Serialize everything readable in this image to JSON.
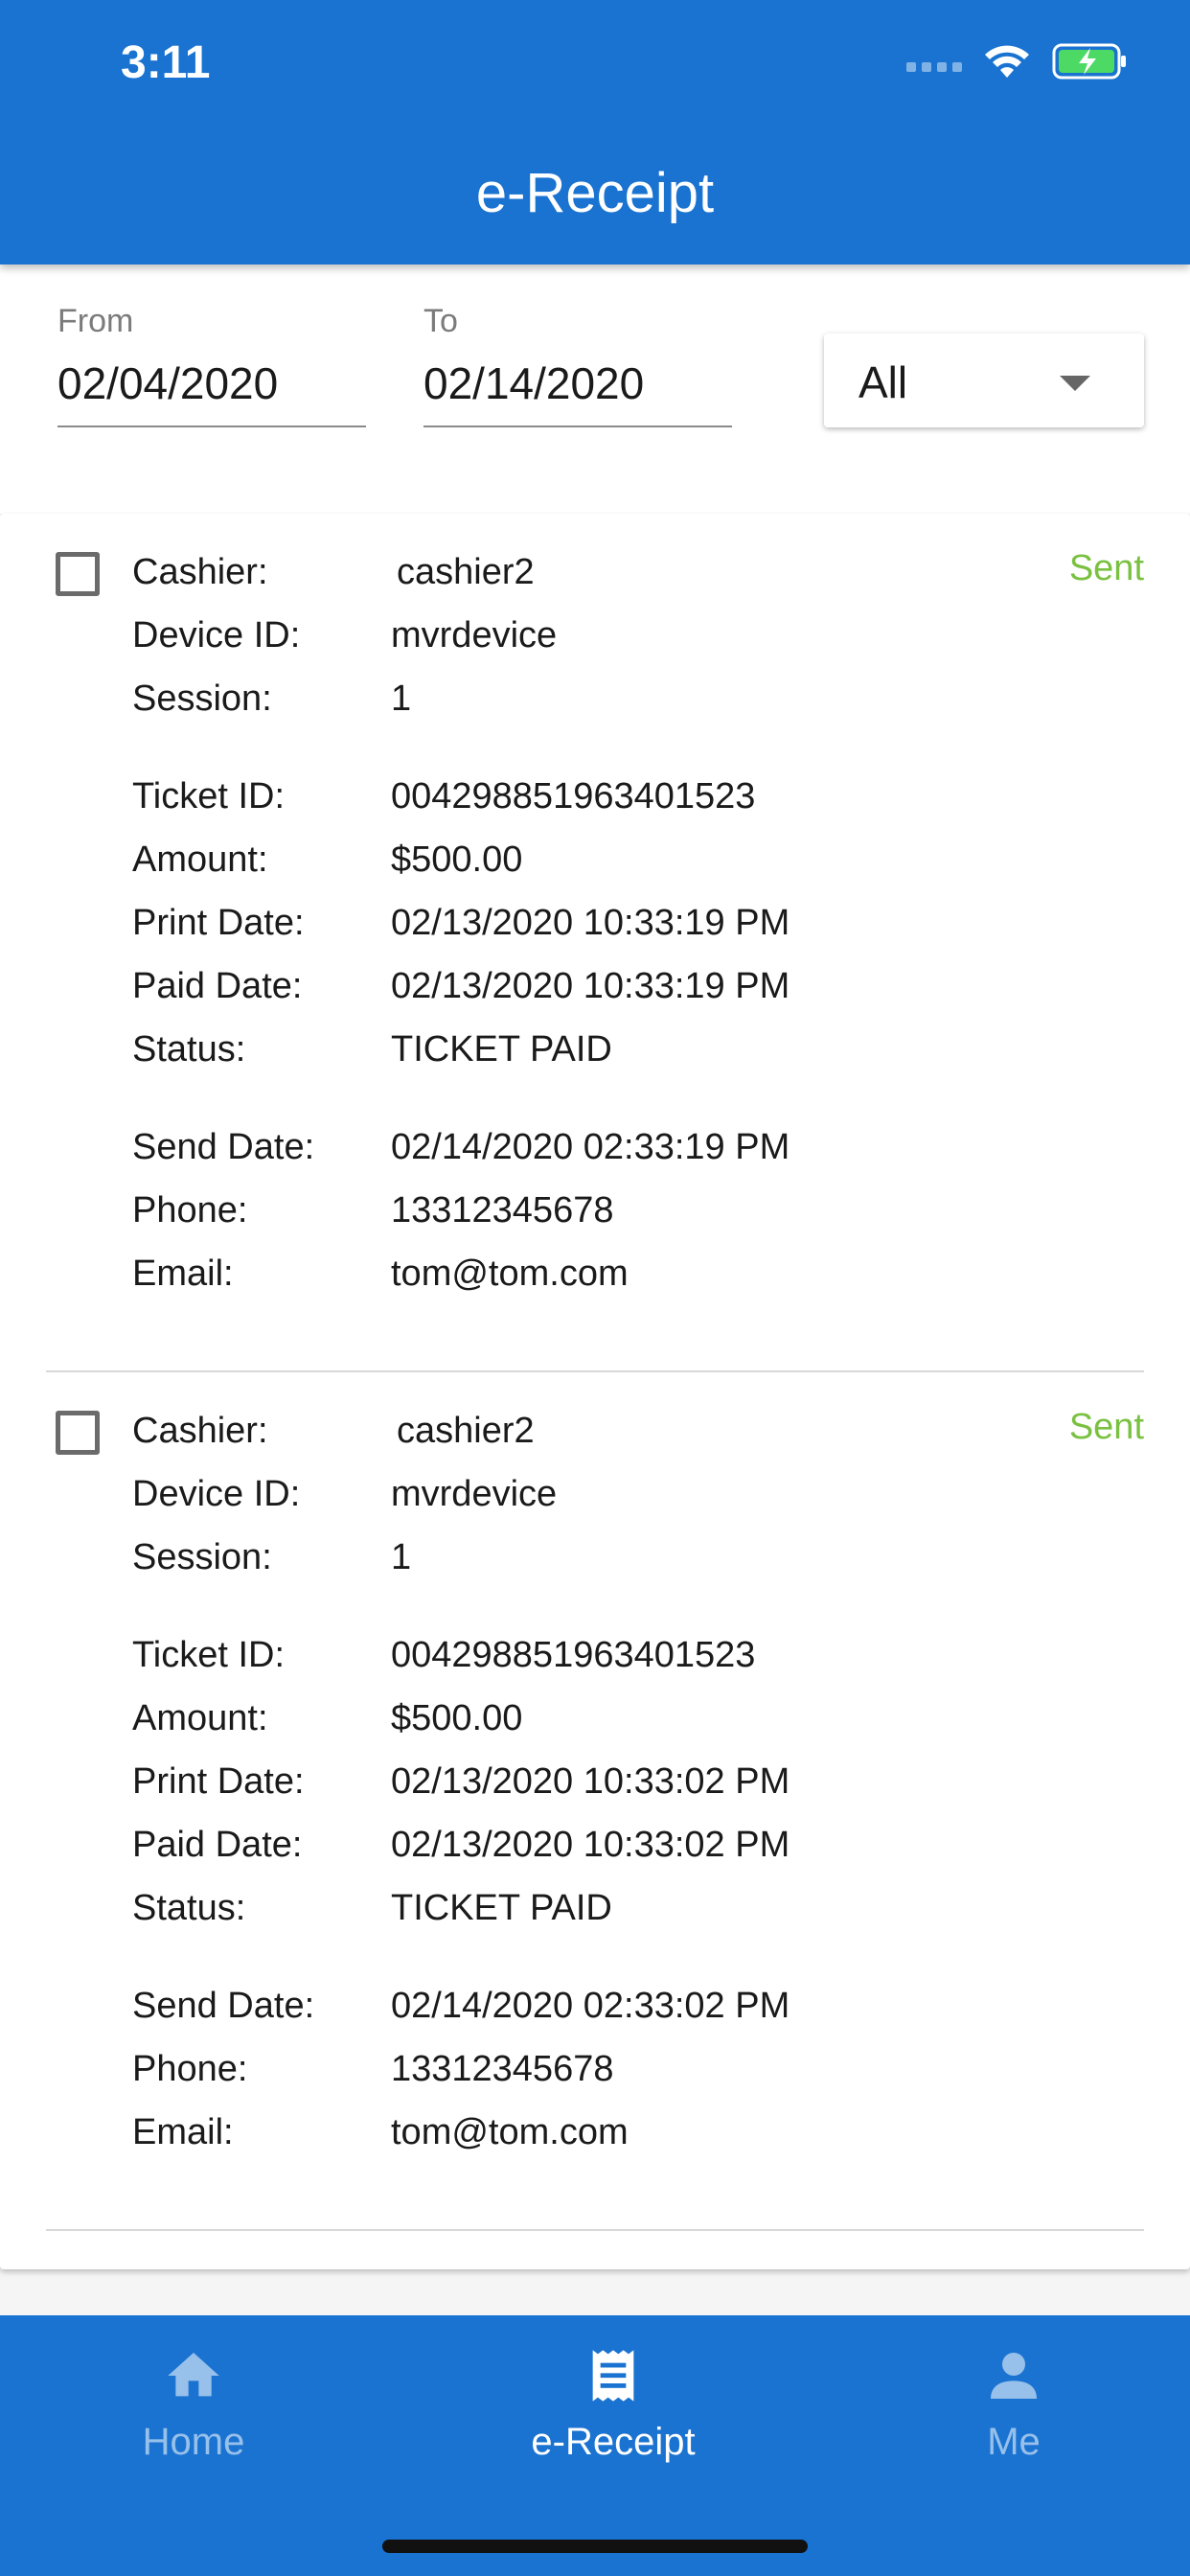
{
  "status_bar": {
    "time": "3:11"
  },
  "header": {
    "title": "e-Receipt"
  },
  "filter": {
    "from_label": "From",
    "from_value": "02/04/2020",
    "to_label": "To",
    "to_value": "02/14/2020",
    "type_selected": "All"
  },
  "labels": {
    "cashier": "Cashier:",
    "device_id": "Device ID:",
    "session": "Session:",
    "ticket_id": "Ticket ID:",
    "amount": "Amount:",
    "print_date": "Print Date:",
    "paid_date": "Paid Date:",
    "status": "Status:",
    "send_date": "Send Date:",
    "phone": "Phone:",
    "email": "Email:"
  },
  "receipts": [
    {
      "state": "Sent",
      "cashier": "cashier2",
      "device_id": "mvrdevice",
      "session": "1",
      "ticket_id": "004298851963401523",
      "amount": "$500.00",
      "print_date": "02/13/2020 10:33:19 PM",
      "paid_date": "02/13/2020 10:33:19 PM",
      "status": "TICKET PAID",
      "send_date": "02/14/2020 02:33:19 PM",
      "phone": "13312345678",
      "email": "tom@tom.com"
    },
    {
      "state": "Sent",
      "cashier": "cashier2",
      "device_id": "mvrdevice",
      "session": "1",
      "ticket_id": "004298851963401523",
      "amount": "$500.00",
      "print_date": "02/13/2020 10:33:02 PM",
      "paid_date": "02/13/2020 10:33:02 PM",
      "status": "TICKET PAID",
      "send_date": "02/14/2020 02:33:02 PM",
      "phone": "13312345678",
      "email": "tom@tom.com"
    }
  ],
  "bottom_nav": {
    "items": [
      {
        "label": "Home",
        "icon": "home-icon"
      },
      {
        "label": "e-Receipt",
        "icon": "receipt-icon"
      },
      {
        "label": "Me",
        "icon": "person-icon"
      }
    ],
    "active": "e-Receipt"
  },
  "colors": {
    "primary": "#1a73d1",
    "sent_status": "#7ac142"
  }
}
